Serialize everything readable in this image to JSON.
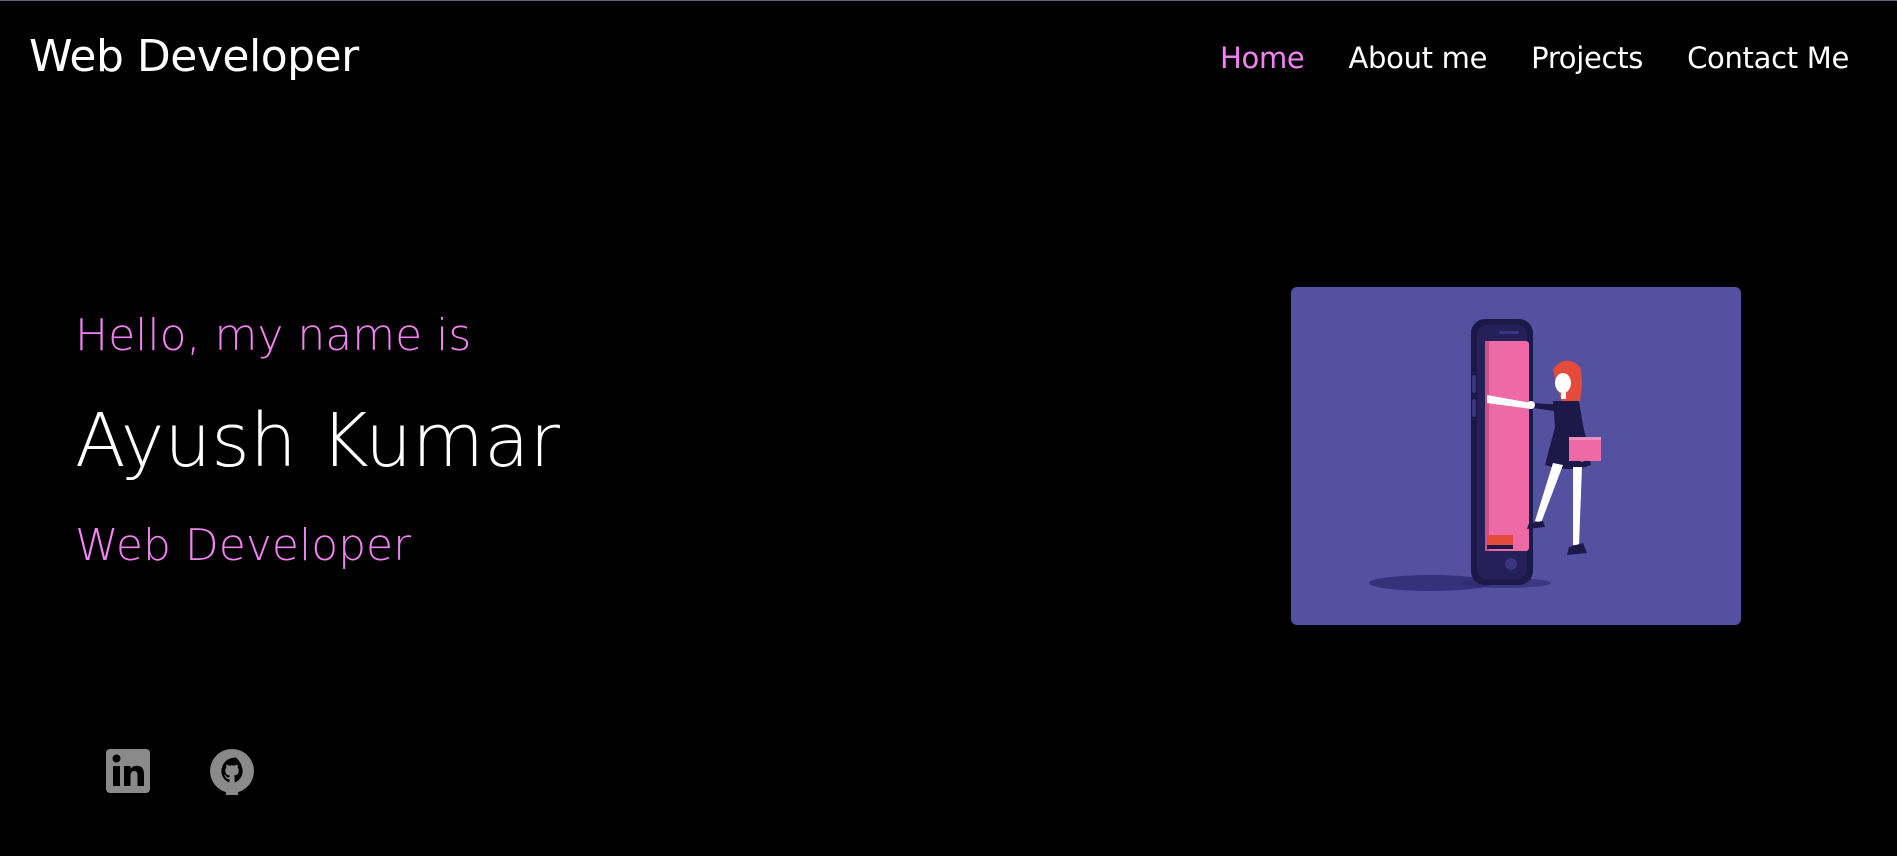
{
  "navbar": {
    "brand": "Web Developer",
    "links": [
      {
        "label": "Home",
        "active": true
      },
      {
        "label": "About me",
        "active": false
      },
      {
        "label": "Projects",
        "active": false
      },
      {
        "label": "Contact Me",
        "active": false
      }
    ]
  },
  "hero": {
    "greeting": "Hello, my name is",
    "name": "Ayush Kumar",
    "role": "Web Developer"
  },
  "illustration": {
    "subject": "woman-stepping-out-of-phone"
  },
  "socials": [
    {
      "icon": "linkedin-icon"
    },
    {
      "icon": "github-icon"
    }
  ],
  "colors": {
    "background": "#000000",
    "accent": "#f382f3",
    "text": "#ffffff",
    "illustration_bg": "#5451a1",
    "icon_gray": "#8a8a8a"
  }
}
